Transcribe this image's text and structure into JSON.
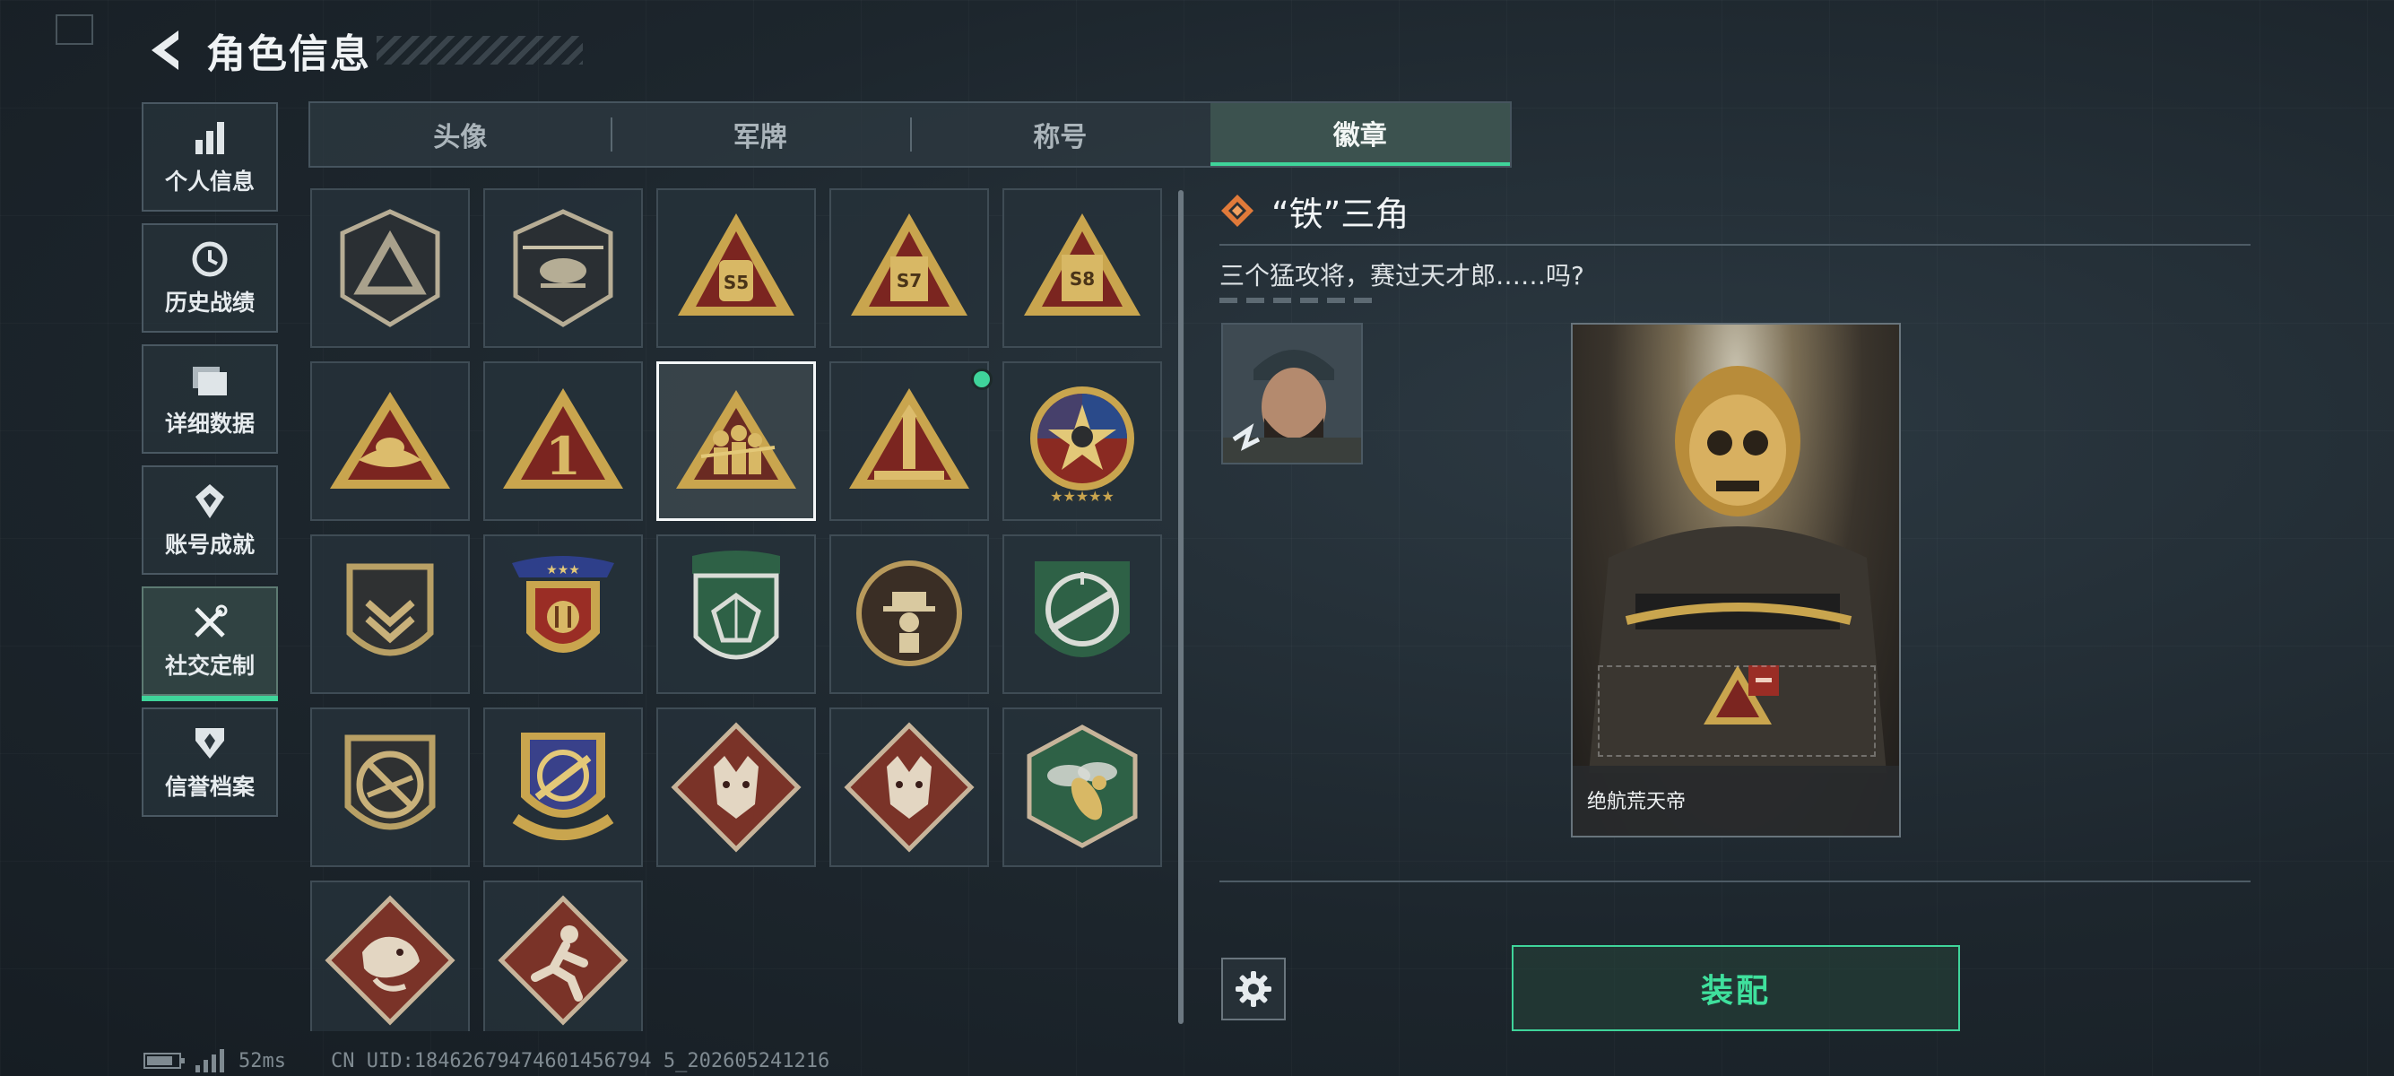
{
  "header": {
    "title": "角色信息",
    "back_icon": "back-arrow-icon"
  },
  "sidebar": {
    "items": [
      {
        "label": "个人信息",
        "icon": "bar-chart-icon",
        "active": false
      },
      {
        "label": "历史战绩",
        "icon": "history-clock-icon",
        "active": false
      },
      {
        "label": "详细数据",
        "icon": "folder-icon",
        "active": false
      },
      {
        "label": "账号成就",
        "icon": "medal-icon",
        "active": false
      },
      {
        "label": "社交定制",
        "icon": "wrench-screwdriver-icon",
        "active": true
      },
      {
        "label": "信誉档案",
        "icon": "shield-badge-icon",
        "active": false
      }
    ]
  },
  "tabs": [
    {
      "label": "头像",
      "active": false
    },
    {
      "label": "军牌",
      "active": false
    },
    {
      "label": "称号",
      "active": false
    },
    {
      "label": "徽章",
      "active": true
    }
  ],
  "badges": [
    {
      "icon": "triangle-logo-badge-icon"
    },
    {
      "icon": "helicopter-badge-icon"
    },
    {
      "icon": "s5-triangle-badge-icon",
      "text": "S5"
    },
    {
      "icon": "s7-triangle-badge-icon",
      "text": "S7"
    },
    {
      "icon": "s8-triangle-badge-icon",
      "text": "S8"
    },
    {
      "icon": "bird-triangle-badge-icon"
    },
    {
      "icon": "number-one-triangle-badge-icon",
      "text": "1"
    },
    {
      "icon": "three-soldiers-triangle-badge-icon",
      "selected": true
    },
    {
      "icon": "rocket-triangle-badge-icon",
      "new": true
    },
    {
      "icon": "star-round-badge-icon"
    },
    {
      "icon": "chevron-shield-badge-icon"
    },
    {
      "icon": "stars-crest-badge-icon"
    },
    {
      "icon": "gem-green-shield-badge-icon"
    },
    {
      "icon": "hat-figure-round-badge-icon"
    },
    {
      "icon": "rifle-green-shield-badge-icon"
    },
    {
      "icon": "no-rifle-shield-badge-icon"
    },
    {
      "icon": "crosshair-crest-badge-icon"
    },
    {
      "icon": "wolf-diamond-badge-icon"
    },
    {
      "icon": "wolf-diamond-badge-icon"
    },
    {
      "icon": "wasp-hexagon-badge-icon"
    },
    {
      "icon": "dragon-diamond-badge-icon"
    },
    {
      "icon": "runner-diamond-badge-icon"
    }
  ],
  "detail": {
    "title": "“铁”三角",
    "description": "三个猛攻将，赛过天才郎……吗?",
    "title_icon": "diamond-rank-icon",
    "preview_caption": "绝航荒天帝",
    "equip_label": "装配",
    "settings_icon": "gear-icon"
  },
  "status": {
    "ping": "52ms",
    "uid": "CN UID:18462679474601456794 5_202605241216"
  },
  "colors": {
    "accent_green": "#3fd49a",
    "gold": "#c9a54e",
    "badge_red": "#8a2a22",
    "badge_green": "#2e6146"
  }
}
